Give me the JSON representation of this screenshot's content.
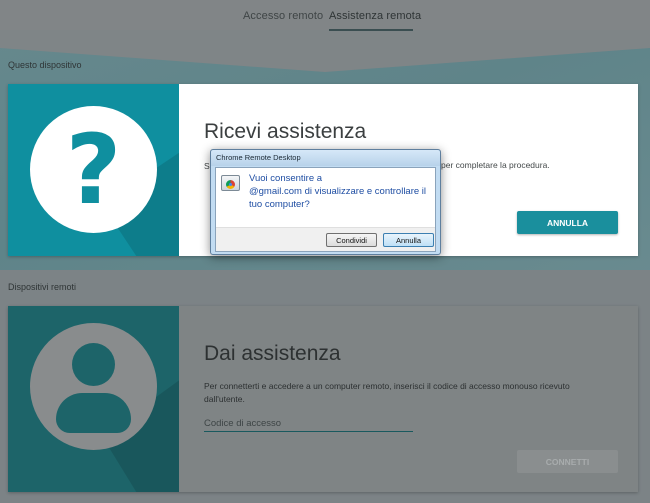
{
  "tabs": [
    {
      "label": "Accesso remoto",
      "selected": false
    },
    {
      "label": "Assistenza remota",
      "selected": true
    }
  ],
  "sections": {
    "this_device": "Questo dispositivo",
    "remote_devices": "Dispositivi remoti"
  },
  "get_help": {
    "title": "Ricevi assistenza",
    "desc_left": "S",
    "desc_right": "per completare la procedura.",
    "cancel_label": "ANNULLA"
  },
  "give_help": {
    "title": "Dai assistenza",
    "desc": "Per connetterti e accedere a un computer remoto, inserisci il codice di accesso monouso ricevuto dall'utente.",
    "input_placeholder": "Codice di accesso",
    "connect_label": "CONNETTI"
  },
  "dialog": {
    "title": "Chrome Remote Desktop",
    "msg_prefix": "Vuoi consentire a",
    "msg_email": "@gmail.com",
    "msg_rest": "di visualizzare e controllare il tuo computer?",
    "share_label": "Condividi",
    "cancel_label": "Annulla"
  },
  "colors": {
    "accent": "#1a8f9d",
    "dark_teal": "#1d6469",
    "dialog_text": "#1f4ea3"
  },
  "icons": {
    "get_help": "question-mark-icon",
    "give_help": "person-icon",
    "dialog_app": "chrome-remote-desktop-icon"
  }
}
